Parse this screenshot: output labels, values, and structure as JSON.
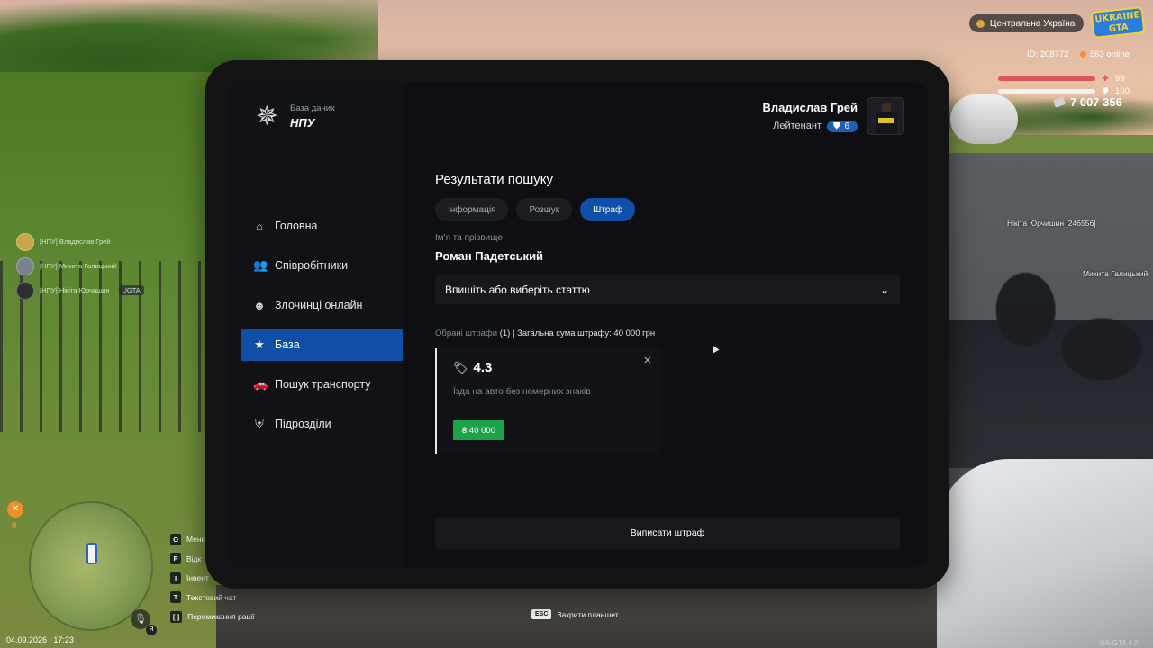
{
  "hud": {
    "region": "Центральна Україна",
    "logo": "UKRAINE GTA",
    "player_id": "ID: 208772",
    "online": "563 online",
    "health": "99",
    "armor": "100",
    "money": "7 007 356",
    "hunger": "0",
    "datetime": "04.09.2026 | 17:23",
    "version": "UA-GTA 4.0",
    "mic_badge": "Я"
  },
  "world_tags": {
    "tag1": "Нікіта Юрчишин [246556]",
    "tag2": "Микита Галицький"
  },
  "radio_chat": [
    {
      "text": "[НПУ] Владислав Грей"
    },
    {
      "text": "[НПУ] Микита Галицький"
    },
    {
      "text": "[НПУ] Нікіта Юрчишин",
      "badge": "UGTA"
    }
  ],
  "keybinds": [
    {
      "key": "O",
      "label": "Меню"
    },
    {
      "key": "P",
      "label": "Відк"
    },
    {
      "key": "I",
      "label": "Інвент"
    },
    {
      "key": "T",
      "label": "Текстовий чат"
    },
    {
      "key": "[  ]",
      "label": "Перемикання рації"
    }
  ],
  "esc_hint": {
    "key": "ESC",
    "label": "Закрити планшет"
  },
  "tablet": {
    "brand": {
      "subtitle": "База даних",
      "title": "НПУ"
    },
    "officer": {
      "name": "Владислав Грей",
      "rank": "Лейтенант",
      "rank_level": "6"
    },
    "nav": [
      {
        "label": "Головна",
        "icon": "home-icon"
      },
      {
        "label": "Співробітники",
        "icon": "users-icon"
      },
      {
        "label": "Злочинці онлайн",
        "icon": "criminal-icon"
      },
      {
        "label": "База",
        "icon": "star-icon",
        "active": true
      },
      {
        "label": "Пошук транспорту",
        "icon": "car-icon"
      },
      {
        "label": "Підрозділи",
        "icon": "shield-icon"
      }
    ],
    "main": {
      "title": "Результати пошуку",
      "tabs": [
        {
          "label": "Інформація"
        },
        {
          "label": "Розшук"
        },
        {
          "label": "Штраф",
          "active": true
        }
      ],
      "name_label": "Ім'я та прізвище",
      "person_name": "Роман Падетський",
      "article_placeholder": "Впишіть або виберіть статтю",
      "summary_prefix": "Обрані штрафи",
      "summary_count": "(1)",
      "summary_total": "| Загальна сума штрафу: 40 000 грн",
      "fines": [
        {
          "code": "4.3",
          "description": "Їзда на авто без номерних знаків",
          "amount": "₴ 40 000"
        }
      ],
      "issue_button": "Виписати штраф"
    }
  },
  "colors": {
    "accent": "#0f4fa8",
    "money_green": "#1ea14b",
    "health": "#e0545c"
  }
}
